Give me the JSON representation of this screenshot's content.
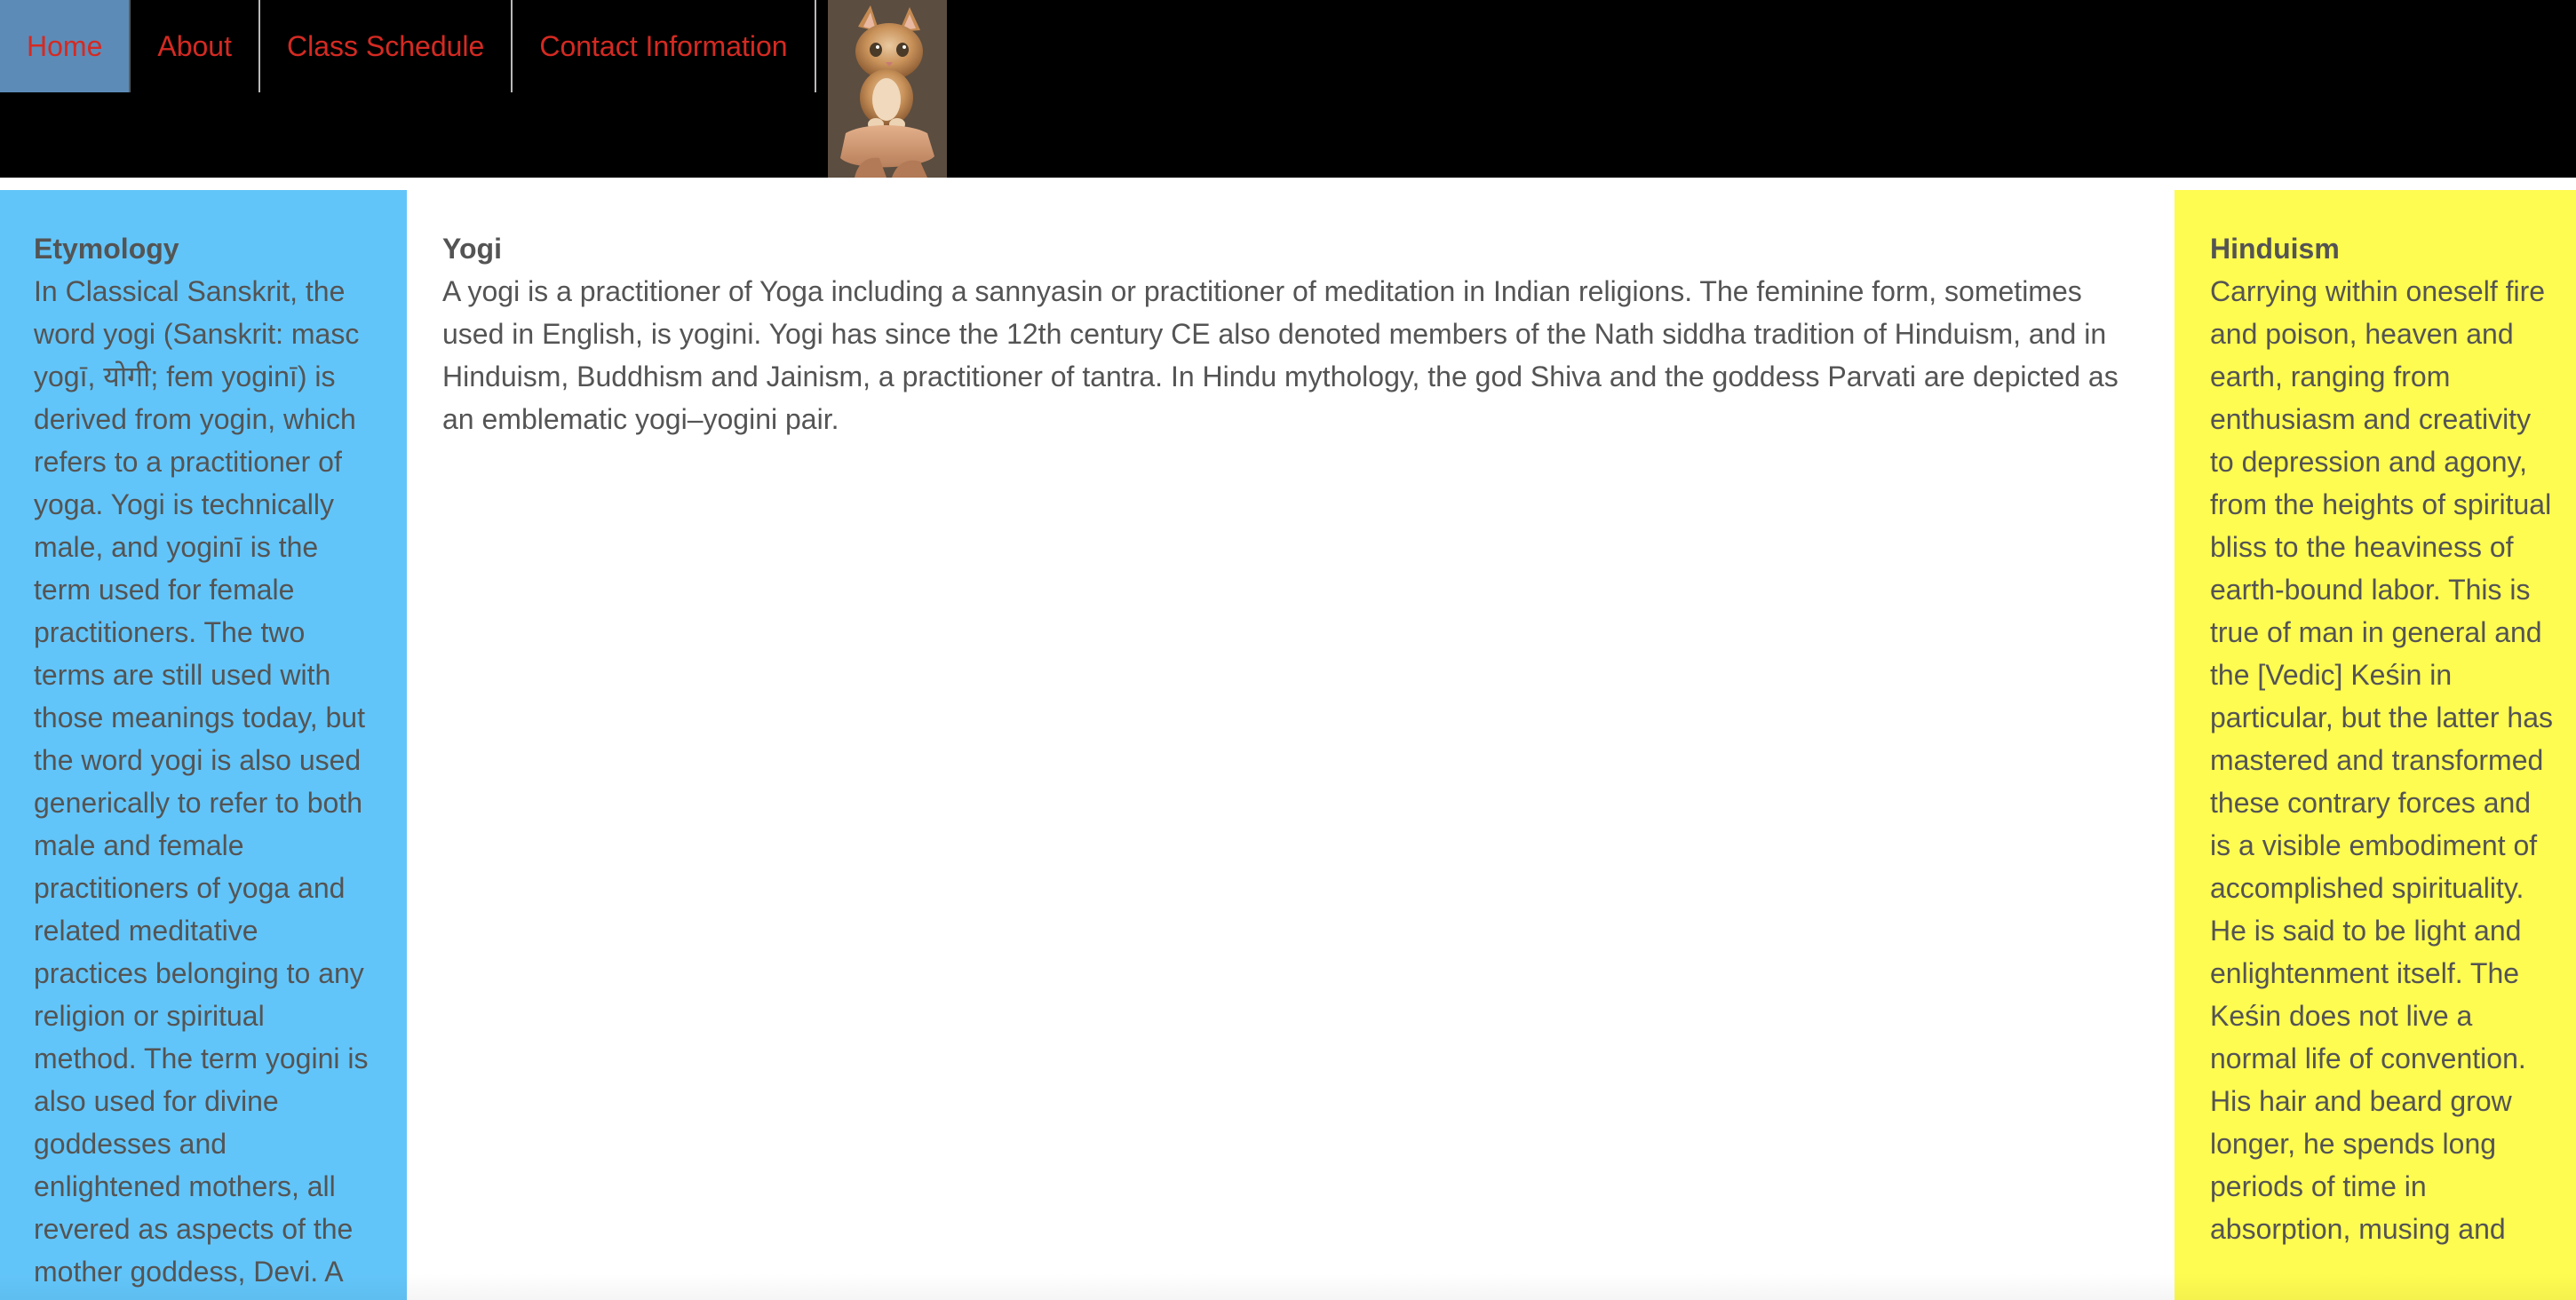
{
  "nav": {
    "items": [
      {
        "label": "Home",
        "active": true
      },
      {
        "label": "About",
        "active": false
      },
      {
        "label": "Class Schedule",
        "active": false
      },
      {
        "label": "Contact Information",
        "active": false
      }
    ],
    "link_color": "#d42a22",
    "active_bg": "#5d8bb8"
  },
  "header": {
    "image": "kitten-photo"
  },
  "left": {
    "heading": "Etymology",
    "text": "In Classical Sanskrit, the word yogi (Sanskrit: masc yogī, योगी; fem yoginī) is derived from yogin, which refers to a practitioner of yoga. Yogi is technically male, and yoginī is the term used for female practitioners. The two terms are still used with those meanings today, but the word yogi is also used generically to refer to both male and female practitioners of yoga and related meditative practices belonging to any religion or spiritual method. The term yogini is also used for divine goddesses and enlightened mothers, all revered as aspects of the mother goddess, Devi. A",
    "bg": "#62c5f9"
  },
  "main": {
    "heading": "Yogi",
    "text": "A yogi is a practitioner of Yoga including a sannyasin or practitioner of meditation in Indian religions. The feminine form, sometimes used in English, is yogini. Yogi has since the 12th century CE also denoted members of the Nath siddha tradition of Hinduism, and in Hinduism, Buddhism and Jainism, a practitioner of tantra. In Hindu mythology, the god Shiva and the goddess Parvati are depicted as an emblematic yogi–yogini pair."
  },
  "right": {
    "heading": "Hinduism",
    "text": "Carrying within oneself fire and poison, heaven and earth, ranging from enthusiasm and creativity to depression and agony, from the heights of spiritual bliss to the heaviness of earth-bound labor. This is true of man in general and the [Vedic] Keśin in particular, but the latter has mastered and transformed these contrary forces and is a visible embodiment of accomplished spirituality. He is said to be light and enlightenment itself. The Keśin does not live a normal life of convention. His hair and beard grow longer, he spends long periods of time in absorption, musing and",
    "bg": "#fefb51"
  }
}
